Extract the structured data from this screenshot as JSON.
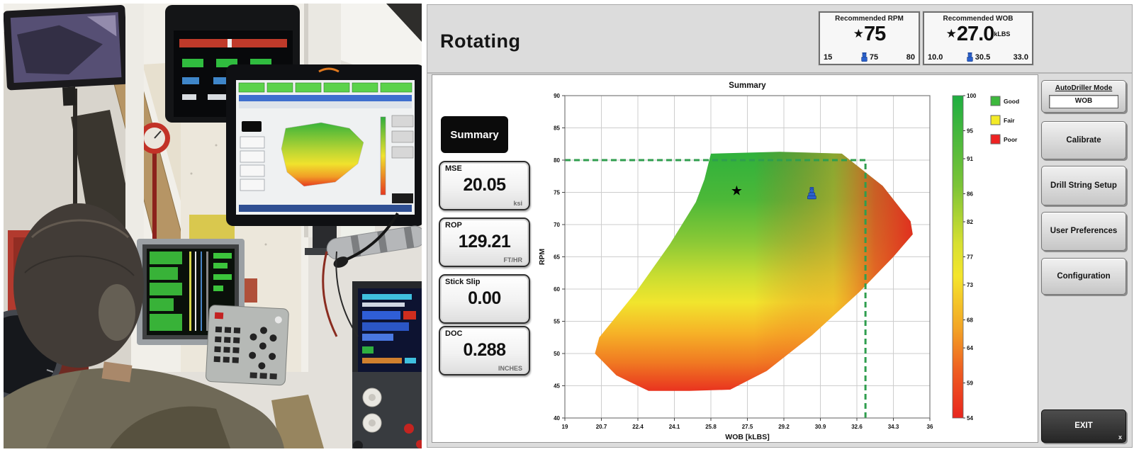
{
  "header": {
    "title": "Rotating",
    "recommended_rpm": {
      "title": "Recommended RPM",
      "star_icon": "★",
      "star_value": "75",
      "min": "15",
      "current": "75",
      "max": "80"
    },
    "recommended_wob": {
      "title": "Recommended WOB",
      "star_icon": "★",
      "star_value": "27.0",
      "unit": "kLBS",
      "min": "10.0",
      "current": "30.5",
      "max": "33.0"
    }
  },
  "metrics": {
    "summary_label": "Summary",
    "items": [
      {
        "label": "MSE",
        "value": "20.05",
        "unit": "ksi"
      },
      {
        "label": "ROP",
        "value": "129.21",
        "unit": "FT/HR"
      },
      {
        "label": "Stick Slip",
        "value": "0.00",
        "unit": ""
      },
      {
        "label": "DOC",
        "value": "0.288",
        "unit": "INCHES"
      }
    ]
  },
  "chart_data": {
    "type": "heatmap",
    "title": "Summary",
    "xlabel": "WOB [kLBS]",
    "ylabel": "RPM",
    "xlim": [
      19,
      36
    ],
    "ylim": [
      40,
      90
    ],
    "x_ticks": [
      "19",
      "20.7",
      "22.4",
      "24.1",
      "25.8",
      "27.5",
      "29.2",
      "30.9",
      "32.6",
      "34.3",
      "36"
    ],
    "y_ticks": [
      90,
      85,
      80,
      75,
      70,
      65,
      60,
      55,
      50,
      45,
      40
    ],
    "grid": true,
    "colorbar": {
      "ticks": [
        100,
        95,
        91,
        86,
        82,
        77,
        73,
        68,
        64,
        59,
        54
      ],
      "good_color": "#2fb13c",
      "fair_color": "#f1e52d",
      "poor_color": "#e9331f"
    },
    "legend": [
      {
        "label": "Good",
        "color": "#3db83d"
      },
      {
        "label": "Fair",
        "color": "#f3ea27"
      },
      {
        "label": "Poor",
        "color": "#ee2222"
      }
    ],
    "markers": [
      {
        "name": "recommended-point",
        "symbol": "star",
        "glyph": "★",
        "x": 27.0,
        "y": 75.2,
        "color": "#000000"
      },
      {
        "name": "current-driller-point",
        "symbol": "driller-icon",
        "x": 30.5,
        "y": 74.8,
        "color": "#2b62cc"
      }
    ],
    "limit_lines": [
      {
        "axis": "y",
        "value": 80,
        "from": 19,
        "to": 33,
        "style": "dashed",
        "color": "#2f9e4e"
      },
      {
        "axis": "x",
        "value": 33,
        "from": 40,
        "to": 80,
        "style": "dashed",
        "color": "#2f9e4e"
      }
    ],
    "region_polygon": [
      [
        25.8,
        81
      ],
      [
        29.0,
        81.3
      ],
      [
        31.9,
        81
      ],
      [
        33.8,
        76
      ],
      [
        35.1,
        70.5
      ],
      [
        35.2,
        68.5
      ],
      [
        34.3,
        65
      ],
      [
        32.7,
        59.5
      ],
      [
        30.5,
        52.8
      ],
      [
        28.4,
        47.3
      ],
      [
        26.7,
        44.4
      ],
      [
        24.8,
        44.2
      ],
      [
        22.9,
        44.2
      ],
      [
        21.4,
        46.6
      ],
      [
        20.4,
        50
      ],
      [
        20.6,
        52.5
      ],
      [
        22.3,
        59.5
      ],
      [
        23.9,
        67
      ],
      [
        25.1,
        73.5
      ],
      [
        25.5,
        77
      ]
    ]
  },
  "right_panel": {
    "autodriller": {
      "label": "AutoDriller Mode",
      "value": "WOB"
    },
    "buttons": [
      "Calibrate",
      "Drill String Setup",
      "User Preferences",
      "Configuration"
    ],
    "exit_label": "EXIT",
    "exit_close": "x"
  },
  "photo": {
    "alt": "Drilling rig operator cabin with monitors (photo)"
  }
}
